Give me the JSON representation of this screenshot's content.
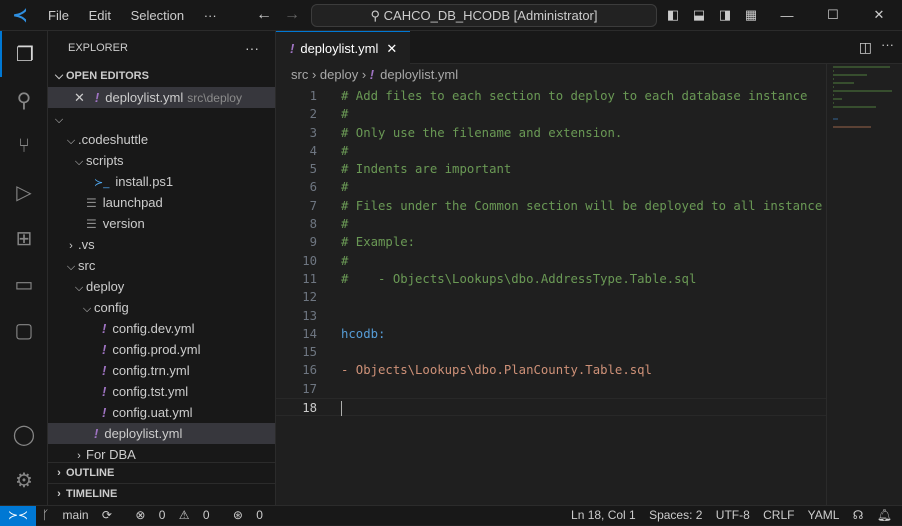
{
  "titlebar": {
    "menu": [
      "File",
      "Edit",
      "Selection",
      "···"
    ],
    "search": "CAHCO_DB_HCODB [Administrator]"
  },
  "explorer": {
    "title": "EXPLORER",
    "more": "···",
    "open_editors": "OPEN EDITORS",
    "open_item": {
      "name": "deploylist.yml",
      "path": "src\\deploy"
    },
    "tree": [
      {
        "label": ".codeshuttle",
        "type": "folder-open",
        "depth": 1
      },
      {
        "label": "scripts",
        "type": "folder-open",
        "depth": 2
      },
      {
        "label": "install.ps1",
        "type": "ps",
        "depth": 3
      },
      {
        "label": "launchpad",
        "type": "file",
        "depth": 2
      },
      {
        "label": "version",
        "type": "file",
        "depth": 2
      },
      {
        "label": ".vs",
        "type": "folder-closed",
        "depth": 1
      },
      {
        "label": "src",
        "type": "folder-open",
        "depth": 1
      },
      {
        "label": "deploy",
        "type": "folder-open",
        "depth": 2
      },
      {
        "label": "config",
        "type": "folder-open",
        "depth": 3
      },
      {
        "label": "config.dev.yml",
        "type": "yml",
        "depth": 4
      },
      {
        "label": "config.prod.yml",
        "type": "yml",
        "depth": 4
      },
      {
        "label": "config.trn.yml",
        "type": "yml",
        "depth": 4
      },
      {
        "label": "config.tst.yml",
        "type": "yml",
        "depth": 4
      },
      {
        "label": "config.uat.yml",
        "type": "yml",
        "depth": 4
      },
      {
        "label": "deploylist.yml",
        "type": "yml",
        "depth": 3,
        "selected": true
      },
      {
        "label": "For DBA",
        "type": "folder-closed",
        "depth": 2
      }
    ],
    "outline": "OUTLINE",
    "timeline": "TIMELINE"
  },
  "tab": {
    "label": "deploylist.yml"
  },
  "breadcrumb": [
    "src",
    "deploy",
    "deploylist.yml"
  ],
  "code": [
    {
      "n": "1",
      "t": "# Add files to each section to deploy to each database instance",
      "c": "c"
    },
    {
      "n": "2",
      "t": "#",
      "c": "c"
    },
    {
      "n": "3",
      "t": "# Only use the filename and extension.",
      "c": "c"
    },
    {
      "n": "4",
      "t": "#",
      "c": "c"
    },
    {
      "n": "5",
      "t": "# Indents are important",
      "c": "c"
    },
    {
      "n": "6",
      "t": "#",
      "c": "c"
    },
    {
      "n": "7",
      "t": "# Files under the Common section will be deployed to all instance",
      "c": "c"
    },
    {
      "n": "8",
      "t": "#",
      "c": "c"
    },
    {
      "n": "9",
      "t": "# Example:",
      "c": "c"
    },
    {
      "n": "10",
      "t": "#",
      "c": "c"
    },
    {
      "n": "11",
      "t": "#    - Objects\\Lookups\\dbo.AddressType.Table.sql",
      "c": "c"
    },
    {
      "n": "12",
      "t": "",
      "c": "p"
    },
    {
      "n": "13",
      "t": "",
      "c": "p"
    },
    {
      "n": "14",
      "t": "hcodb:",
      "c": "k"
    },
    {
      "n": "15",
      "t": "",
      "c": "p"
    },
    {
      "n": "16",
      "t": "- Objects\\Lookups\\dbo.PlanCounty.Table.sql",
      "c": "s"
    },
    {
      "n": "17",
      "t": "",
      "c": "p"
    },
    {
      "n": "18",
      "t": "",
      "c": "p"
    }
  ],
  "status": {
    "branch": "main",
    "errors": "0",
    "warnings": "0",
    "ports": "0",
    "position": "Ln 18, Col 1",
    "spaces": "Spaces: 2",
    "encoding": "UTF-8",
    "eol": "CRLF",
    "language": "YAML"
  }
}
